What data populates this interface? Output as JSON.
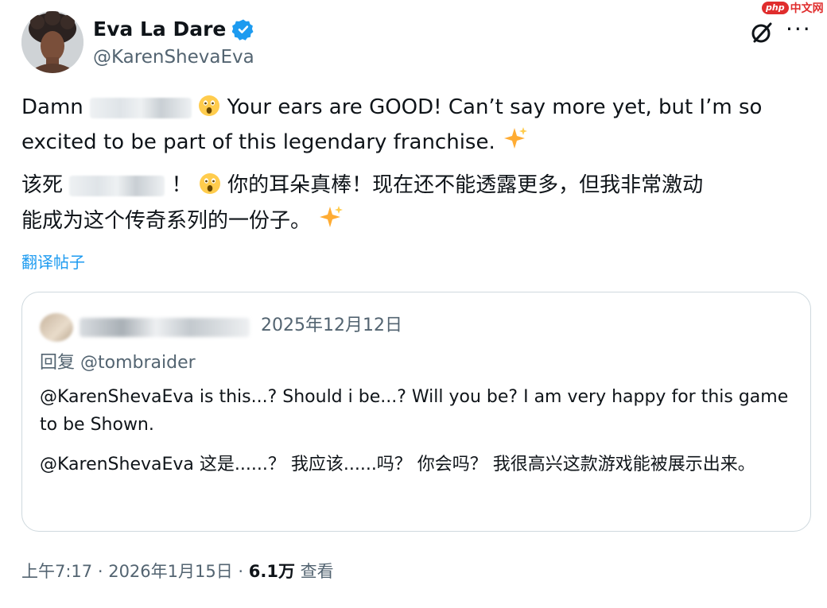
{
  "watermark": {
    "logo": "php",
    "text": "中文网"
  },
  "author": {
    "display_name": "Eva La Dare",
    "handle": "@KarenShevaEva"
  },
  "tweet": {
    "en_part1": "Damn",
    "en_part2": "Your ears are GOOD! Can’t say more yet, but I’m so",
    "en_line2": "excited to be part of this legendary franchise.",
    "zh_part1": "该死",
    "zh_part2": "！",
    "zh_part3": "你的耳朵真棒！现在还不能透露更多，但我非常激动",
    "zh_line2": "能成为这个传奇系列的一份子。",
    "translate_label": "翻译帖子"
  },
  "quote": {
    "date": "2025年12月12日",
    "reply_to_label": "回复",
    "reply_to_handle": "@tombraider",
    "text_en": "@KarenShevaEva is this...? Should i be...? Will you be? I am very happy for this game to be Shown.",
    "text_zh": "@KarenShevaEva 这是......？ 我应该......吗？ 你会吗？ 我很高兴这款游戏能被展示出来。"
  },
  "meta": {
    "time": "上午7:17",
    "separator": " · ",
    "date": "2026年1月15日",
    "views_count": "6.1万",
    "views_label": " 查看"
  },
  "icons": {
    "verified": "verified-badge-icon",
    "grok": "grok-icon",
    "more": "more-icon"
  },
  "colors": {
    "accent": "#1d9bf0",
    "secondary_text": "#536471",
    "primary_text": "#0f1419",
    "border": "#cfd9de"
  }
}
